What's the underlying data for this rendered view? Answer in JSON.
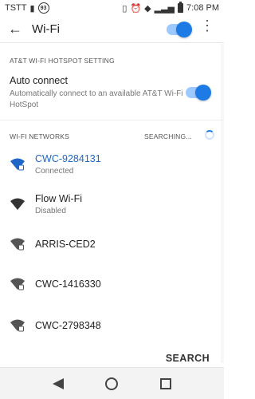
{
  "status_bar": {
    "carrier": "TSTT",
    "badge": "93",
    "time": "7:08 PM"
  },
  "app_bar": {
    "title": "Wi-Fi"
  },
  "hotspot": {
    "header": "AT&T WI-FI HOTSPOT SETTING",
    "title": "Auto connect",
    "description": "Automatically connect to an available AT&T Wi-Fi HotSpot"
  },
  "networks_section": {
    "header": "WI-FI NETWORKS",
    "status": "SEARCHING..."
  },
  "networks": [
    {
      "name": "CWC-9284131",
      "sub": "Connected",
      "connected": true,
      "locked": true
    },
    {
      "name": "Flow Wi-Fi",
      "sub": "Disabled",
      "connected": false,
      "locked": false
    },
    {
      "name": "ARRIS-CED2",
      "sub": "",
      "connected": false,
      "locked": true
    },
    {
      "name": "CWC-1416330",
      "sub": "",
      "connected": false,
      "locked": true
    },
    {
      "name": "CWC-2798348",
      "sub": "",
      "connected": false,
      "locked": true
    }
  ],
  "actions": {
    "search": "SEARCH"
  },
  "colors": {
    "accent": "#1e7be6",
    "connected_text": "#1e66c7"
  }
}
